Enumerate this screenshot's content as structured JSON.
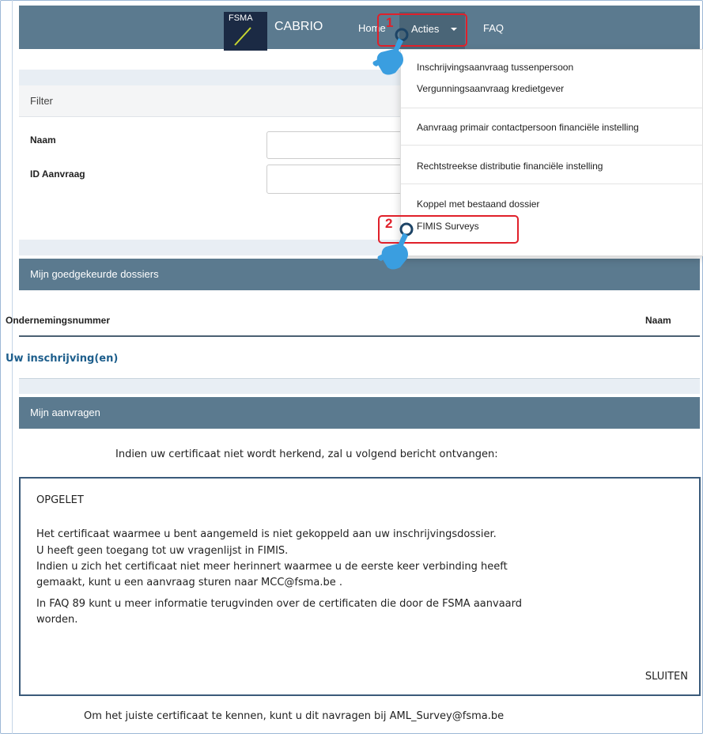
{
  "navbar": {
    "logo_text": "FSMA",
    "brand": "CABRIO",
    "home": "Home",
    "acties": "Acties",
    "faq": "FAQ"
  },
  "callouts": {
    "step1": "1",
    "step2": "2"
  },
  "dropdown": {
    "items": [
      "Inschrijvingsaanvraag tussenpersoon",
      "Vergunningsaanvraag kredietgever",
      "Aanvraag primair contactpersoon financiële instelling",
      "Rechtstreekse distributie financiële instelling",
      "Koppel met bestaand dossier",
      "FIMIS Surveys"
    ]
  },
  "filter": {
    "title": "Filter",
    "naam_label": "Naam",
    "id_label": "ID Aanvraag"
  },
  "approved": {
    "title": "Mijn goedgekeurde dossiers",
    "col_number": "Ondernemingsnummer",
    "col_name": "Naam",
    "link": "Uw inschrijving(en)"
  },
  "requests": {
    "title": "Mijn aanvragen"
  },
  "caption_top": "Indien uw certificaat niet wordt herkend, zal u volgend bericht ontvangen:",
  "alert": {
    "title": "OPGELET",
    "lines": [
      "Het certificaat waarmee u bent aangemeld is niet gekoppeld aan uw inschrijvingsdossier.",
      " U heeft geen toegang tot uw vragenlijst in FIMIS.",
      "Indien u zich het certificaat niet meer herinnert waarmee u de eerste keer verbinding heeft",
      "gemaakt, kunt u een aanvraag sturen naar MCC@fsma.be .",
      " In FAQ 89 kunt u meer informatie terugvinden over de certificaten die door de FSMA aanvaard",
      "worden."
    ],
    "close": "SLUITEN"
  },
  "caption_bottom": "Om het juiste certificaat te kennen, kunt u dit navragen bij AML_Survey@fsma.be",
  "colors": {
    "navbar": "#5b7a8f",
    "accent_red": "#e0202a",
    "hand_blue": "#3a9ee0",
    "link": "#1d5e8c"
  }
}
